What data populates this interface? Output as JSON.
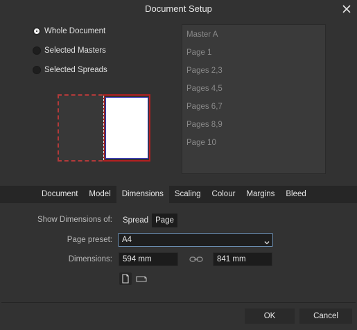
{
  "window": {
    "title": "Document Setup"
  },
  "scope": {
    "options": [
      {
        "label": "Whole Document",
        "checked": true
      },
      {
        "label": "Selected Masters",
        "checked": false
      },
      {
        "label": "Selected Spreads",
        "checked": false
      }
    ]
  },
  "pages": [
    "Master A",
    "Page 1",
    "Pages 2,3",
    "Pages 4,5",
    "Pages 6,7",
    "Pages 8,9",
    "Page 10"
  ],
  "tabs": {
    "items": [
      "Document",
      "Model",
      "Dimensions",
      "Scaling",
      "Colour",
      "Margins",
      "Bleed"
    ],
    "active": "Dimensions"
  },
  "form": {
    "show_dimensions_label": "Show Dimensions of:",
    "show_dimensions_options": [
      "Spread",
      "Page"
    ],
    "show_dimensions_selected": "Page",
    "preset_label": "Page preset:",
    "preset_value": "A4",
    "dimensions_label": "Dimensions:",
    "width_value": "594 mm",
    "height_value": "841 mm"
  },
  "buttons": {
    "ok": "OK",
    "cancel": "Cancel"
  },
  "colors": {
    "bleed_border": "#b32020",
    "page_border": "#3a3ab8",
    "focus_border": "#6a8cae"
  }
}
